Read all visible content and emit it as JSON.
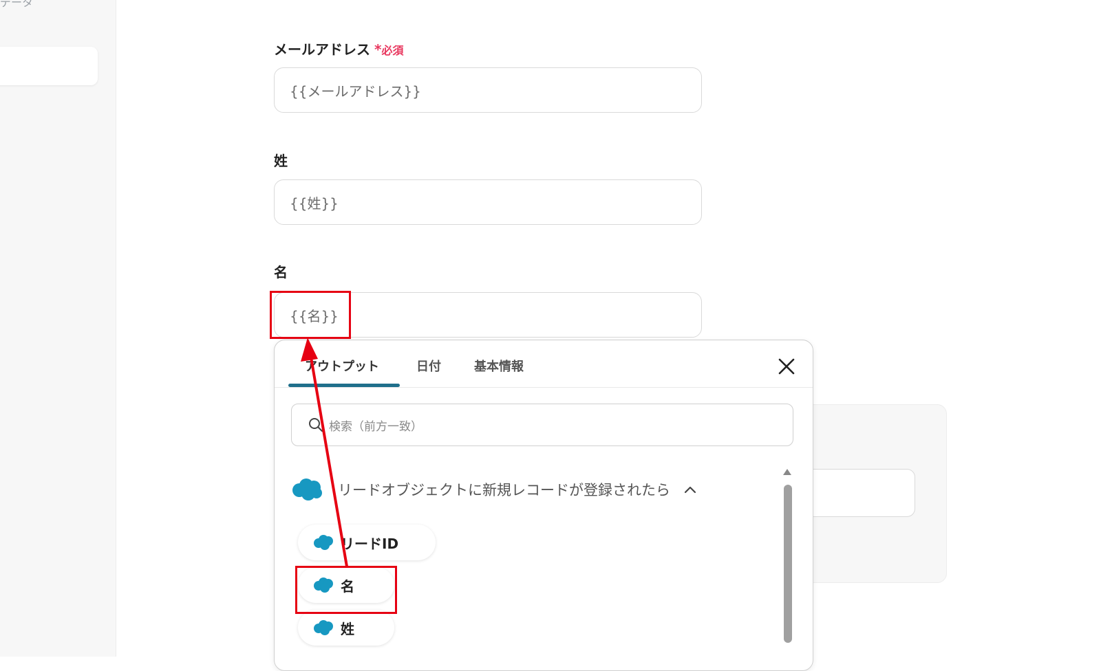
{
  "sidebar": {
    "top_text": "データ"
  },
  "form": {
    "email": {
      "label": "メールアドレス",
      "required_mark": "*",
      "required_text": "必須",
      "value": "{{メールアドレス}}"
    },
    "last_name": {
      "label": "姓",
      "value": "{{姓}}"
    },
    "first_name": {
      "label": "名",
      "value": "{{名}}"
    }
  },
  "popup": {
    "tabs": [
      {
        "label": "アウトプット",
        "active": true
      },
      {
        "label": "日付",
        "active": false
      },
      {
        "label": "基本情報",
        "active": false
      }
    ],
    "close_icon": "close-icon",
    "search_placeholder": "検索（前方一致）",
    "group": {
      "icon": "salesforce-cloud-icon",
      "title": "リードオブジェクトに新規レコードが登録されたら",
      "expanded": true
    },
    "items": [
      {
        "label": "リードID"
      },
      {
        "label": "名"
      },
      {
        "label": "姓"
      }
    ]
  },
  "colors": {
    "required": "#e8385f",
    "highlight": "#e60012",
    "tab_active": "#1f6f8b",
    "salesforce": "#1798c1"
  }
}
